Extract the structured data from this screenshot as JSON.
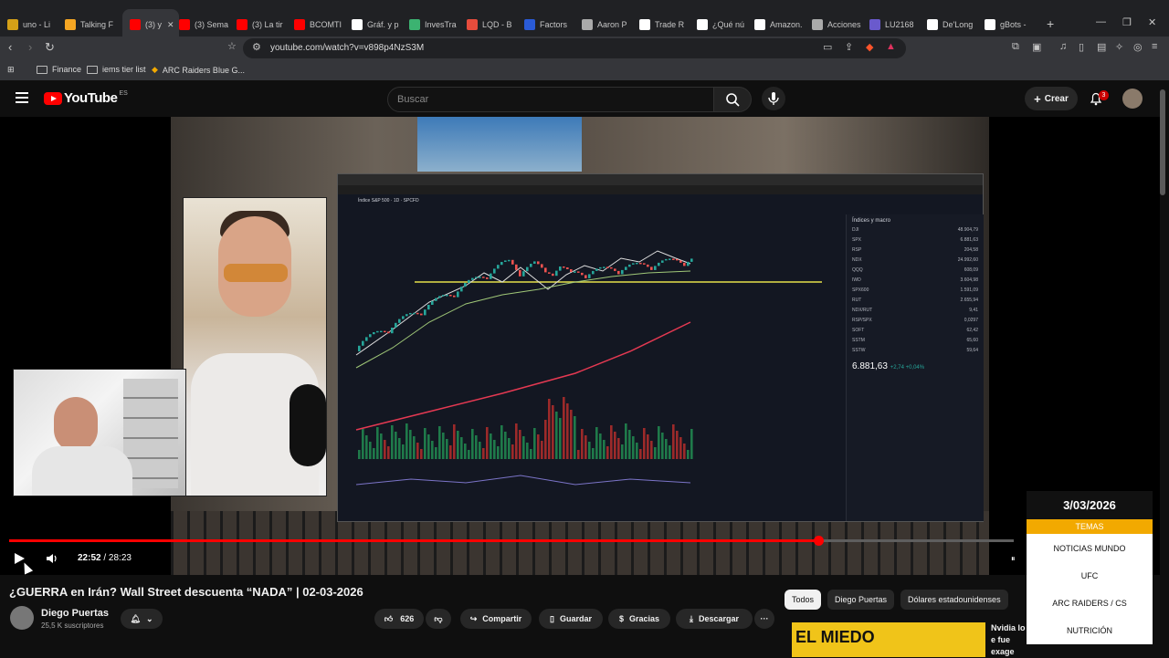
{
  "browser": {
    "tabs": [
      {
        "label": "uno - Li",
        "color": "#d4a017"
      },
      {
        "label": "Talking F",
        "color": "#f5a623"
      },
      {
        "label": "(3) y",
        "color": "#ff0000"
      },
      {
        "label": "(3) Sema",
        "color": "#ff0000"
      },
      {
        "label": "(3) La tir",
        "color": "#ff0000"
      },
      {
        "label": "BCOMTI",
        "color": "#ff0000"
      },
      {
        "label": "Gráf. y p",
        "color": "#ffffff"
      },
      {
        "label": "InvesTra",
        "color": "#3cb371"
      },
      {
        "label": "LQD - B",
        "color": "#e74c3c"
      },
      {
        "label": "Factors",
        "color": "#2a5bd7"
      },
      {
        "label": "Aaron P",
        "color": "#aaaaaa"
      },
      {
        "label": "Trade R",
        "color": "#ffffff"
      },
      {
        "label": "¿Qué nú",
        "color": "#ffffff"
      },
      {
        "label": "Amazon.",
        "color": "#ffffff"
      },
      {
        "label": "Acciones",
        "color": "#aaaaaa"
      },
      {
        "label": "LU2168",
        "color": "#6a5acd"
      },
      {
        "label": "De'Long",
        "color": "#ffffff"
      },
      {
        "label": "gBots -",
        "color": "#ffffff"
      }
    ],
    "new_tab": "+",
    "url": "youtube.com/watch?v=v898p4NzS3M",
    "bookmarks": [
      "Finance",
      "iems tier list",
      "ARC Raiders Blue G..."
    ]
  },
  "youtube": {
    "logo_text": "YouTube",
    "country": "ES",
    "search_placeholder": "Buscar",
    "create_label": "Crear",
    "notifications_count": "3"
  },
  "player": {
    "current_time": "22:52",
    "duration": "28:23",
    "separator": " / ",
    "progress_fraction": 0.805
  },
  "tradingview": {
    "index_title": "Índice S&P 500 · 1D · SPCFD",
    "watchlist_title": "Índices y macro",
    "rows": [
      {
        "sym": "DJI",
        "price": "48.904,79"
      },
      {
        "sym": "SPX",
        "price": "6.881,63"
      },
      {
        "sym": "RSP",
        "price": "204,58"
      },
      {
        "sym": "NDX",
        "price": "24.992,60"
      },
      {
        "sym": "QQQ",
        "price": "608,09"
      },
      {
        "sym": "IWD",
        "price": "3.604,98"
      },
      {
        "sym": "SPX600",
        "price": "1.591,09"
      },
      {
        "sym": "RUT",
        "price": "2.655,94"
      },
      {
        "sym": "NDX/RUT",
        "price": "9,41"
      },
      {
        "sym": "RSP/SPX",
        "price": "0,0297"
      },
      {
        "sym": "SOFT",
        "price": "62,42"
      },
      {
        "sym": "SSTM",
        "price": "65,60"
      },
      {
        "sym": "SSTW",
        "price": "59,64"
      }
    ],
    "spx_price": "6.881,63",
    "spx_change": "+2,74 +0,04%"
  },
  "overlay": {
    "date": "3/03/2026",
    "header": "TEMAS",
    "items": [
      "NOTICIAS MUNDO",
      "UFC",
      "ARC RAIDERS / CS",
      "NUTRICIÓN"
    ]
  },
  "video": {
    "title": "¿GUERRA en Irán? Wall Street descuenta “NADA” | 02-03-2026",
    "channel": "Diego Puertas",
    "subscribers": "25,5 K suscriptores",
    "likes": "626",
    "share_label": "Compartir",
    "save_label": "Guardar",
    "thanks_label": "Gracias",
    "download_label": "Descargar",
    "more_label": "···"
  },
  "chips": [
    "Todos",
    "Diego Puertas",
    "Dólares estadounidenses"
  ],
  "related": {
    "thumb_text": "EL MIEDO",
    "title": "Nvidia lo e fue exage"
  }
}
